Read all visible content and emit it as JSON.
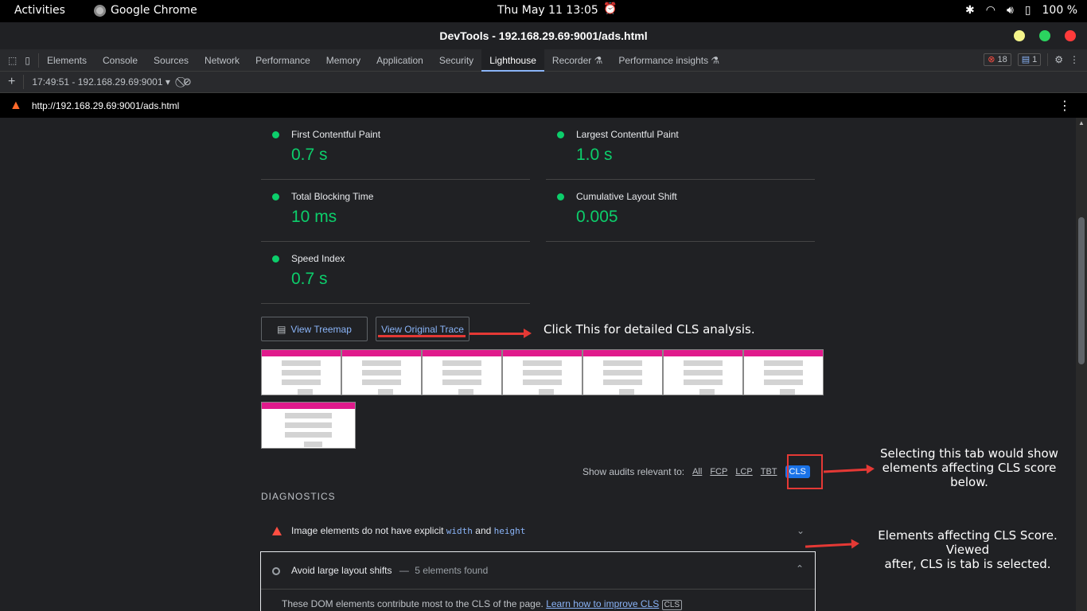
{
  "system_bar": {
    "activities": "Activities",
    "app_name": "Google Chrome",
    "clock": "Thu May 11  13:05",
    "battery": "100 %"
  },
  "window": {
    "title": "DevTools - 192.168.29.69:9001/ads.html"
  },
  "devtools_tabs": [
    "Elements",
    "Console",
    "Sources",
    "Network",
    "Performance",
    "Memory",
    "Application",
    "Security",
    "Lighthouse",
    "Recorder ⚗",
    "Performance insights ⚗"
  ],
  "active_tab": "Lighthouse",
  "badges": {
    "errors": "18",
    "messages": "1"
  },
  "report_selector": "17:49:51 - 192.168.29.69:9001",
  "url": "http://192.168.29.69:9001/ads.html",
  "metrics": [
    {
      "label": "First Contentful Paint",
      "value": "0.7 s"
    },
    {
      "label": "Largest Contentful Paint",
      "value": "1.0 s"
    },
    {
      "label": "Total Blocking Time",
      "value": "10 ms"
    },
    {
      "label": "Cumulative Layout Shift",
      "value": "0.005"
    },
    {
      "label": "Speed Index",
      "value": "0.7 s"
    }
  ],
  "buttons": {
    "treemap": "View Treemap",
    "trace": "View Original Trace"
  },
  "annotations": {
    "trace": "Click This for detailed CLS analysis.",
    "cls_tab_line1": "Selecting this  tab would show",
    "cls_tab_line2": "elements affecting CLS score",
    "cls_tab_line3": "below.",
    "elements_line1": "Elements affecting CLS Score. Viewed",
    "elements_line2": "after, CLS is tab is selected."
  },
  "filters": {
    "label": "Show audits relevant to:",
    "options": [
      "All",
      "FCP",
      "LCP",
      "TBT",
      "CLS"
    ]
  },
  "diagnostics": {
    "heading": "DIAGNOSTICS",
    "audit1_text": "Image elements do not have explicit",
    "audit1_code1": "width",
    "audit1_and": "and",
    "audit1_code2": "height",
    "audit2_title": "Avoid large layout shifts",
    "audit2_sep": "—",
    "audit2_count": "5 elements found",
    "audit2_desc": "These DOM elements contribute most to the CLS of the page.",
    "audit2_link": "Learn how to improve CLS",
    "audit2_tag": "CLS"
  },
  "colors": {
    "pass": "#0cce6b",
    "fail": "#ff4e42",
    "link": "#8ab4f8",
    "annotation_red": "#e53935"
  }
}
